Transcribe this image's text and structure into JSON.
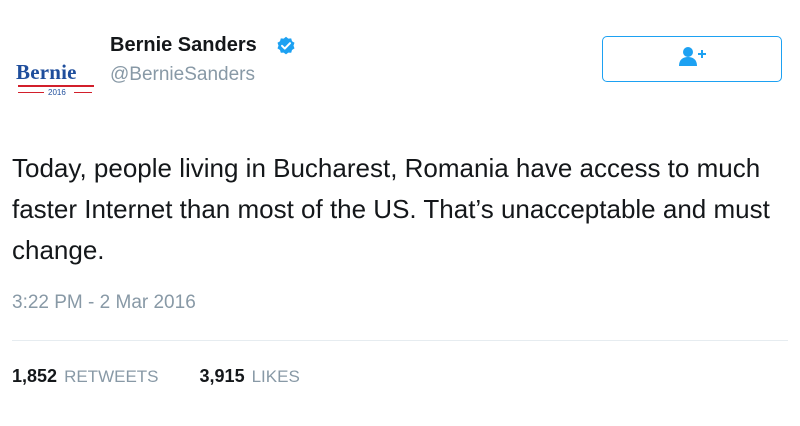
{
  "header": {
    "avatar": {
      "logo_text": "Bernie",
      "logo_year": "2016"
    },
    "name": "Bernie Sanders",
    "handle": "@BernieSanders",
    "verified_icon": "verified-badge-icon",
    "follow_icon": "follow-user-plus-icon"
  },
  "tweet": {
    "text": "Today, people living in Bucharest, Romania have access to much faster Internet than most of the US. That’s unacceptable and must change.",
    "timestamp": "3:22 PM - 2 Mar 2016"
  },
  "stats": {
    "retweets_count": "1,852",
    "retweets_label": "RETWEETS",
    "likes_count": "3,915",
    "likes_label": "LIKES"
  },
  "colors": {
    "accent": "#1da1f2",
    "text": "#14171a",
    "muted": "#8899a6",
    "logo_blue": "#1f4e9c",
    "logo_red": "#d21f2b"
  }
}
